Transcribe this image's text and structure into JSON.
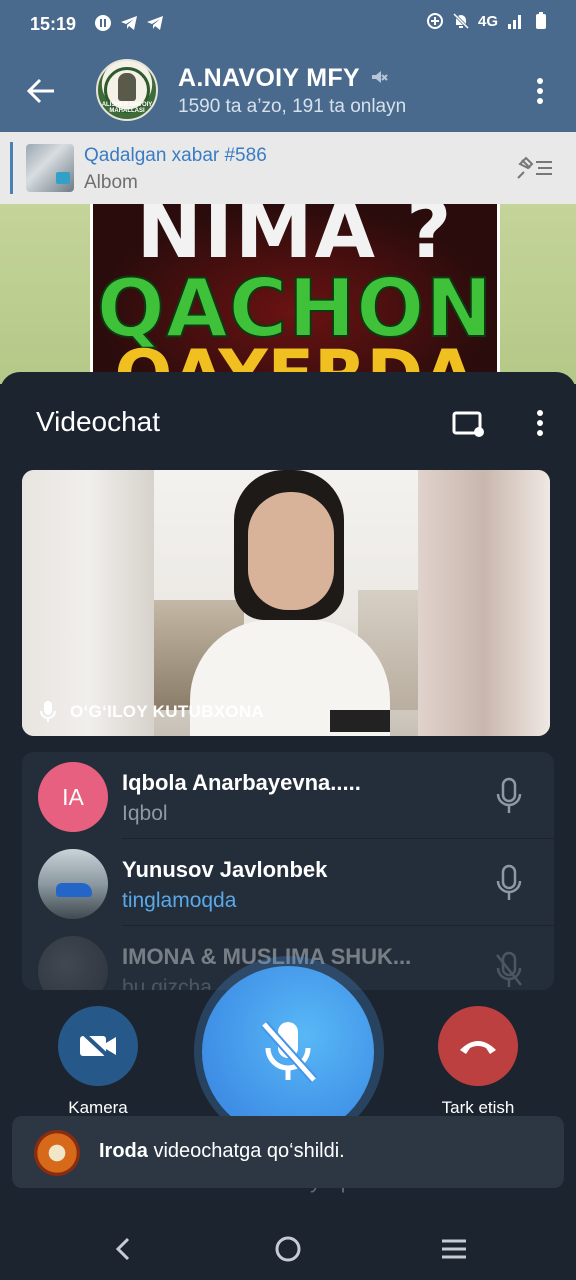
{
  "status_bar": {
    "time": "15:19",
    "network": "4G",
    "icons": [
      "record-icon",
      "telegram-icon",
      "telegram-icon",
      "add-circle-icon",
      "bell-off-icon",
      "signal-icon",
      "battery-icon"
    ]
  },
  "header": {
    "title": "A.NAVOIY MFY",
    "subtitle": "1590 ta a’zo, 191 ta onlayn",
    "avatar_text": "ALISHER NAVOIY MAHALLASI"
  },
  "pinned": {
    "title": "Qadalgan xabar #586",
    "subtitle": "Albom"
  },
  "poster": {
    "line1": "NIMA ?",
    "line2": "QACHON ?",
    "line3": "QAYERDA ?"
  },
  "videochat": {
    "title": "Videochat",
    "video_label": "O‘G‘ILOY KUTUBXONA",
    "participants": [
      {
        "initials": "IA",
        "name": "Iqbola Anarbayevna.....",
        "status": "Iqbol",
        "status_color": "gray"
      },
      {
        "initials": "",
        "name": "Yunusov Javlonbek",
        "status": "tinglamoqda",
        "status_color": "blue"
      },
      {
        "initials": "",
        "name": "IMONA & MUSLIMA SHUK...",
        "status": "bu qizcha",
        "status_color": "gray"
      }
    ],
    "camera_label": "Kamera",
    "leave_label": "Tark etish",
    "mic_hint": "Mikrofonni yoqish"
  },
  "toast": {
    "name": "Iroda",
    "text": " videochatga qo‘shildi."
  },
  "colors": {
    "header_bg": "#4a6a8d",
    "sheet_bg": "#1c242f",
    "mic_button": "#3f8fe6",
    "end_button": "#bd4040",
    "camera_button": "#26598a",
    "link_blue": "#59a9e8"
  }
}
